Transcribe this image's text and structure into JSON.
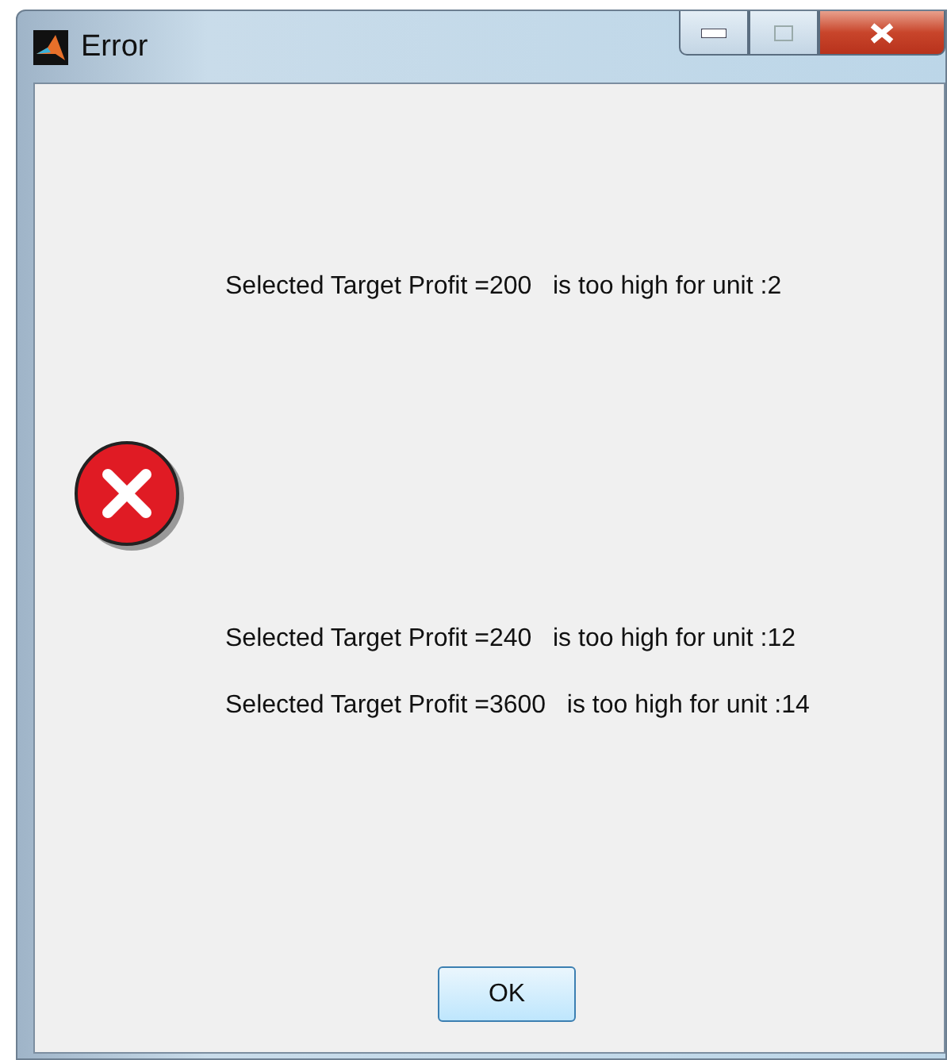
{
  "window": {
    "title": "Error"
  },
  "messages": [
    "Selected Target Profit =200   is too high for unit :2",
    "Selected Target Profit =240   is too high for unit :12",
    "Selected Target Profit =3600   is too high for unit :14"
  ],
  "buttons": [
    "OK"
  ]
}
